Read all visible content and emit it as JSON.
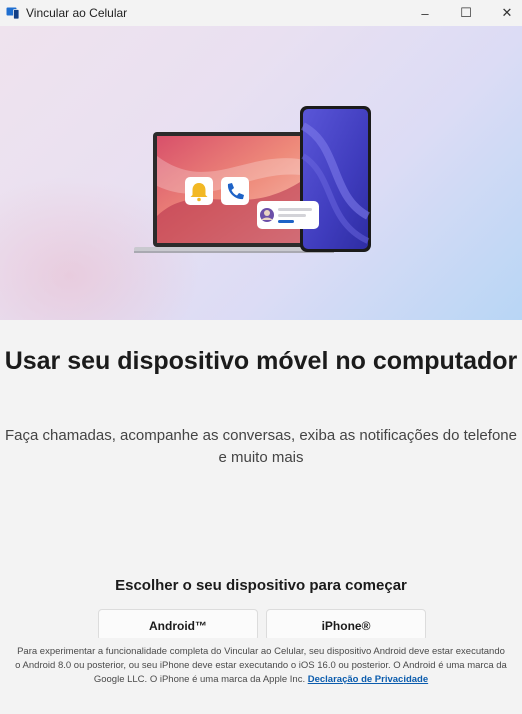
{
  "window": {
    "title": "Vincular ao Celular",
    "controls": {
      "minimize": "–",
      "maximize": "☐",
      "close": "✕"
    }
  },
  "hero": {
    "illustration_icons": [
      "bell-icon",
      "phone-call-icon",
      "message-avatar-icon"
    ]
  },
  "main": {
    "headline": "Usar seu dispositivo móvel no computador",
    "subtext": "Faça chamadas, acompanhe as conversas, exiba as notificações do telefone e muito mais",
    "choose_label": "Escolher o seu dispositivo para começar",
    "buttons": {
      "android": "Android™",
      "iphone": "iPhone®"
    }
  },
  "footer": {
    "disclaimer": "Para experimentar a funcionalidade completa do Vincular ao Celular, seu dispositivo Android deve estar executando o Android 8.0 ou posterior, ou seu iPhone deve estar executando o iOS 16.0 ou posterior. O Android é uma marca da Google LLC. O iPhone é uma marca da Apple Inc. ",
    "privacy_link": "Declaração de Privacidade"
  },
  "colors": {
    "accent_link": "#0b5cad",
    "bell_yellow": "#f2b824",
    "call_blue": "#1e63c7",
    "phone_purple": "#4a47c9"
  }
}
